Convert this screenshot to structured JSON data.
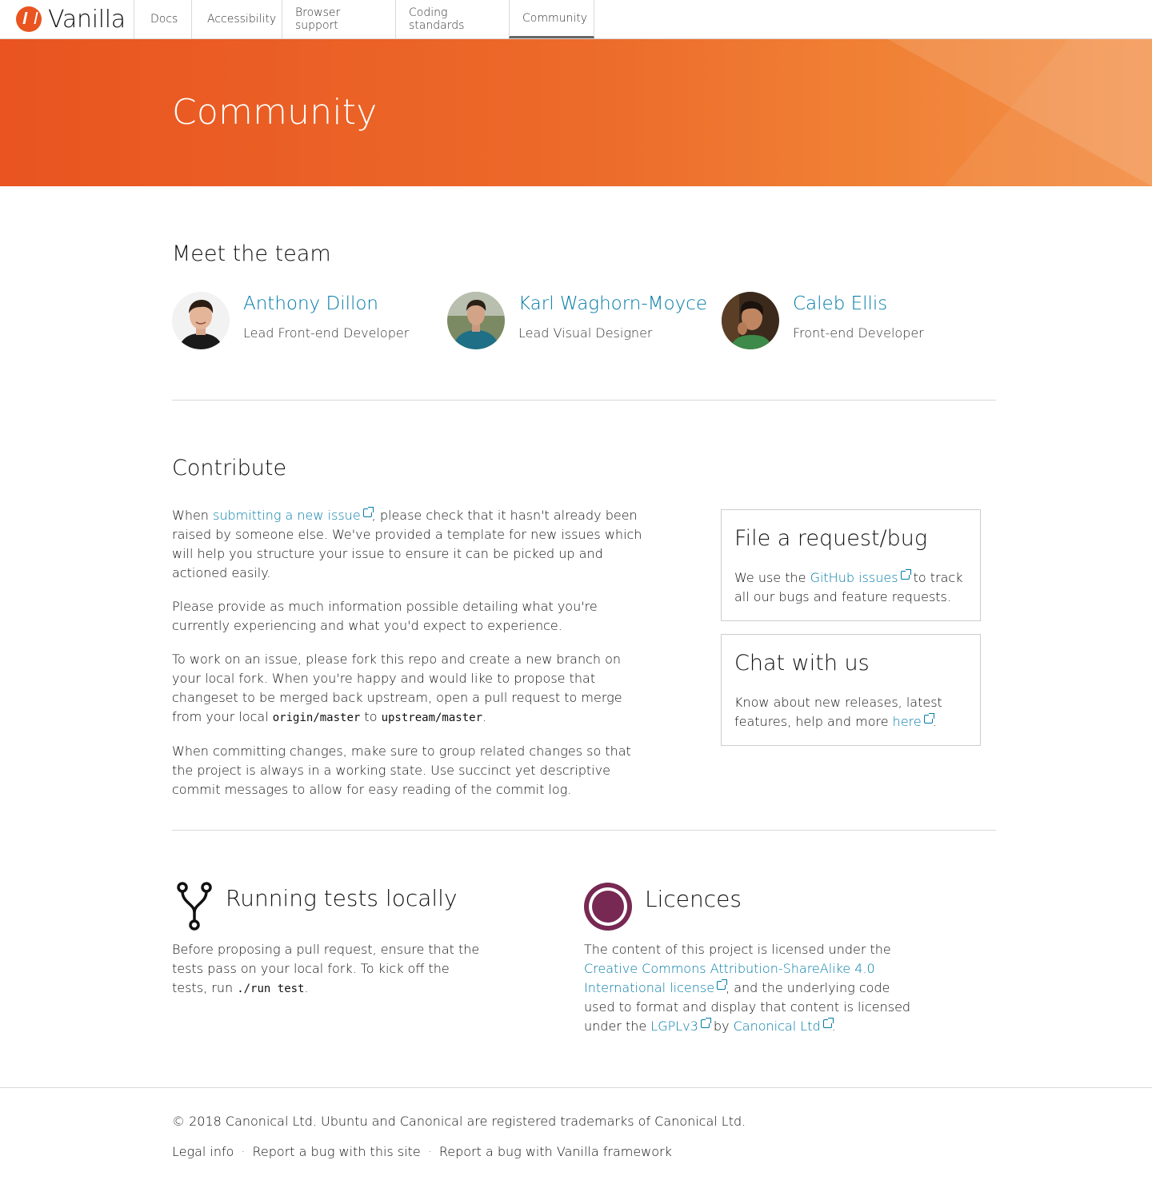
{
  "nav": {
    "brand": "Vanilla",
    "items": [
      {
        "label": "Docs"
      },
      {
        "label": "Accessibility"
      },
      {
        "label": "Browser support"
      },
      {
        "label": "Coding standards"
      },
      {
        "label": "Community"
      }
    ],
    "active": "Community"
  },
  "hero": {
    "title": "Community"
  },
  "team": {
    "title": "Meet the team",
    "members": [
      {
        "name": "Anthony Dillon",
        "role": "Lead Front-end Developer"
      },
      {
        "name": "Karl Waghorn-Moyce",
        "role": "Lead Visual Designer"
      },
      {
        "name": "Caleb Ellis",
        "role": "Front-end Developer"
      }
    ]
  },
  "contribute": {
    "title": "Contribute",
    "p1_pre": "When ",
    "p1_link": "submitting a new issue",
    "p1_post": ", please check that it hasn't already been raised by someone else. We've provided a template for new issues which will help you structure your issue to ensure it can be picked up and actioned easily.",
    "p2": "Please provide as much information possible detailing what you're currently experiencing and what you'd expect to experience.",
    "p3_pre": "To work on an issue, please fork this repo and create a new branch on your local fork. When you're happy and would like to propose that changeset to be merged back upstream, open a pull request to merge from your local ",
    "p3_code1": "origin/master",
    "p3_mid": " to ",
    "p3_code2": "upstream/master",
    "p3_post": ".",
    "p4": "When committing changes, make sure to group related changes so that the project is always in a working state. Use succinct yet descriptive commit messages to allow for easy reading of the commit log."
  },
  "cards": {
    "bug": {
      "title": "File a request/bug",
      "pre": "We use the ",
      "link": "GitHub issues",
      "post": " to track all our bugs and feature requests."
    },
    "chat": {
      "title": "Chat with us",
      "pre": "Know about new releases, latest features, help and more ",
      "link": "here",
      "post": "."
    }
  },
  "tests": {
    "title": "Running tests locally",
    "pre": "Before proposing a pull request, ensure that the tests pass on your local fork. To kick off the tests, run ",
    "code": "./run test",
    "post": "."
  },
  "licences": {
    "title": "Licences",
    "pre": "The content of this project is licensed under the ",
    "link1": "Creative Commons Attribution-ShareAlike 4.0 International license",
    "mid": ", and the underlying code used to format and display that content is licensed under the ",
    "link2": "LGPLv3",
    "by": " by ",
    "link3": "Canonical Ltd",
    "post": "."
  },
  "footer": {
    "copyright": "© 2018 Canonical Ltd. Ubuntu and Canonical are registered trademarks of Canonical Ltd.",
    "links": [
      "Legal info",
      "Report a bug with this site",
      "Report a bug with Vanilla framework"
    ],
    "separator": "·"
  },
  "colors": {
    "brand": "#e95420",
    "link": "#007aa6",
    "licence_icon": "#772953"
  }
}
